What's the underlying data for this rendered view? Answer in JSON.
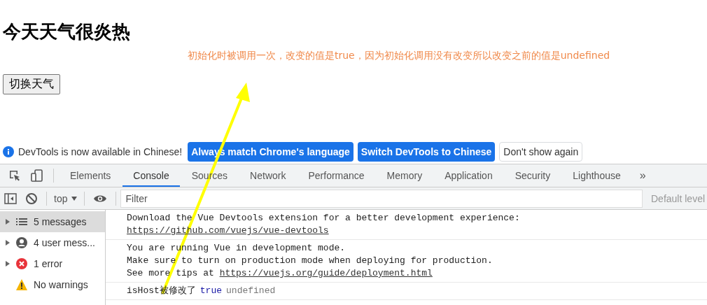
{
  "page": {
    "heading": "今天天气很炎热",
    "note": "初始化时被调用一次，改变的值是true，因为初始化调用没有改变所以改变之前的值是undefined",
    "button": "切换天气"
  },
  "banner": {
    "text": "DevTools is now available in Chinese!",
    "buttons": [
      {
        "label": "Always match Chrome's language",
        "kind": "primary"
      },
      {
        "label": "Switch DevTools to Chinese",
        "kind": "primary"
      },
      {
        "label": "Don't show again",
        "kind": "plain"
      }
    ]
  },
  "tabs": [
    {
      "label": "Elements",
      "selected": false
    },
    {
      "label": "Console",
      "selected": true
    },
    {
      "label": "Sources",
      "selected": false
    },
    {
      "label": "Network",
      "selected": false
    },
    {
      "label": "Performance",
      "selected": false
    },
    {
      "label": "Memory",
      "selected": false
    },
    {
      "label": "Application",
      "selected": false
    },
    {
      "label": "Security",
      "selected": false
    },
    {
      "label": "Lighthouse",
      "selected": false
    }
  ],
  "more_tabs": "»",
  "toolbar": {
    "context": "top",
    "filter_placeholder": "Filter",
    "levels": "Default level"
  },
  "sidebar": [
    {
      "label": "5 messages",
      "kind": "list",
      "selected": true
    },
    {
      "label": "4 user mess...",
      "kind": "user",
      "selected": false
    },
    {
      "label": "1 error",
      "kind": "error",
      "selected": false
    },
    {
      "label": "No warnings",
      "kind": "warning",
      "selected": false
    }
  ],
  "messages": [
    {
      "lines": [
        [
          {
            "kind": "text",
            "text": "Download the Vue Devtools extension for a better development experience:"
          }
        ],
        [
          {
            "kind": "link",
            "text": "https://github.com/vuejs/vue-devtools"
          }
        ]
      ]
    },
    {
      "lines": [
        [
          {
            "kind": "text",
            "text": "You are running Vue in development mode."
          }
        ],
        [
          {
            "kind": "text",
            "text": "Make sure to turn on production mode when deploying for production."
          }
        ],
        [
          {
            "kind": "text",
            "text": "See more tips at "
          },
          {
            "kind": "link",
            "text": "https://vuejs.org/guide/deployment.html"
          }
        ]
      ]
    },
    {
      "lines": [
        [
          {
            "kind": "text",
            "text": "isHost被修改了"
          },
          {
            "kind": "bool",
            "text": "true"
          },
          {
            "kind": "undef",
            "text": "undefined"
          }
        ]
      ]
    }
  ]
}
